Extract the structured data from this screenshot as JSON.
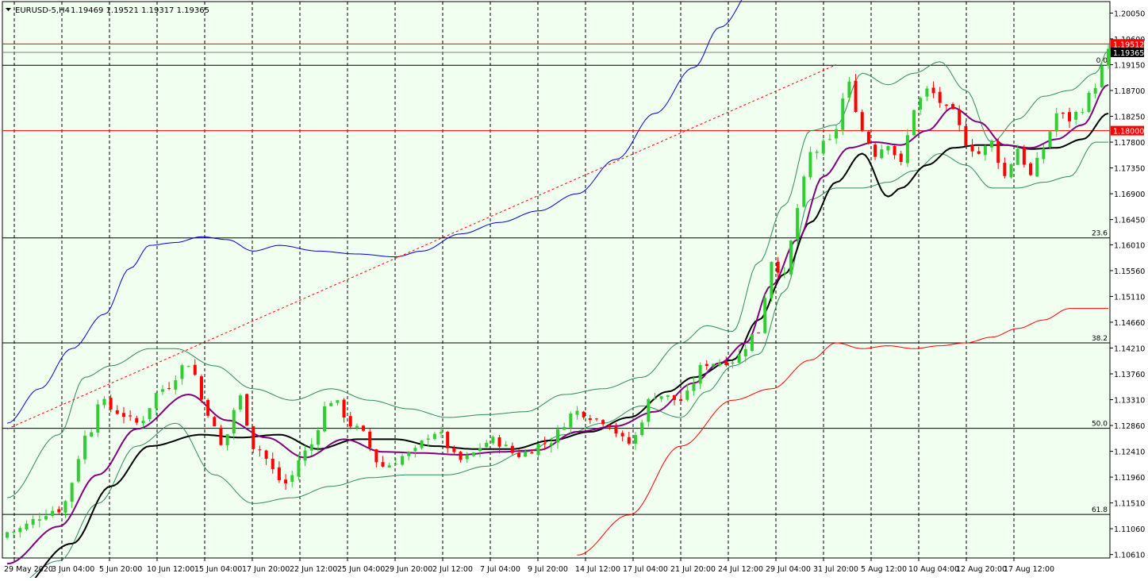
{
  "chart_data": {
    "type": "candlestick",
    "title": "EURUSD-5,H4",
    "ohlc_label": "1.19469 1.19521 1.19317 1.19365",
    "background_color": "#f0fff0",
    "colors": {
      "bull": "#32cd32",
      "bear": "#ff0000",
      "fib": "#000000",
      "hline": "#ff0000",
      "ma_short": "#800080",
      "ma_long": "#000000",
      "bollinger": "#2e8b57",
      "ma_upper": "#0000cd",
      "ma_lower": "#ff0000",
      "trend": "#ff0000"
    },
    "y_axis": {
      "ylim": [
        1.1055,
        1.2025
      ],
      "tick_labels": [
        "1.20050",
        "1.19600",
        "1.19150",
        "1.18700",
        "1.18250",
        "1.17800",
        "1.17350",
        "1.16900",
        "1.16450",
        "1.16010",
        "1.15560",
        "1.15110",
        "1.14660",
        "1.14210",
        "1.13760",
        "1.13310",
        "1.12860",
        "1.12410",
        "1.11960",
        "1.11510",
        "1.11060",
        "1.10610"
      ]
    },
    "x_axis": {
      "tick_labels": [
        "29 May 2020",
        "3 Jun 04:00",
        "5 Jun 20:00",
        "10 Jun 12:00",
        "15 Jun 04:00",
        "17 Jun 20:00",
        "22 Jun 12:00",
        "25 Jun 04:00",
        "29 Jun 20:00",
        "2 Jul 12:00",
        "7 Jul 04:00",
        "9 Jul 20:00",
        "14 Jul 12:00",
        "17 Jul 04:00",
        "21 Jul 20:00",
        "24 Jul 12:00",
        "29 Jul 04:00",
        "31 Jul 20:00",
        "5 Aug 12:00",
        "10 Aug 04:00",
        "12 Aug 20:00",
        "17 Aug 12:00"
      ]
    },
    "price_labels": [
      {
        "value": 1.19512,
        "text": "1.19512",
        "color": "#ff0000"
      },
      {
        "value": 1.19365,
        "text": "1.19365",
        "color": "#000000"
      },
      {
        "value": 1.18,
        "text": "1.18000",
        "color": "#ff0000"
      }
    ],
    "horizontal_lines": [
      {
        "value": 1.19512,
        "color": "#ff0000"
      },
      {
        "value": 1.18,
        "color": "#ff0000"
      },
      {
        "value": 1.19365,
        "color": "#808080"
      }
    ],
    "fibonacci_levels": [
      {
        "label": "0.0",
        "value": 1.1914
      },
      {
        "label": "23.6",
        "value": 1.1613
      },
      {
        "label": "38.2",
        "value": 1.143
      },
      {
        "label": "50.0",
        "value": 1.1281
      },
      {
        "label": "61.8",
        "value": 1.1131
      }
    ],
    "trendline": {
      "start": [
        0,
        1.128
      ],
      "end": [
        128,
        1.1915
      ]
    },
    "candle_count": 171,
    "anchors": {
      "close": [
        [
          0,
          1.11
        ],
        [
          8,
          1.114
        ],
        [
          13,
          1.128
        ],
        [
          14,
          1.133
        ],
        [
          17,
          1.131
        ],
        [
          20,
          1.129
        ],
        [
          24,
          1.135
        ],
        [
          28,
          1.1395
        ],
        [
          31,
          1.131
        ],
        [
          33,
          1.125
        ],
        [
          36,
          1.1335
        ],
        [
          38,
          1.125
        ],
        [
          43,
          1.1185
        ],
        [
          46,
          1.124
        ],
        [
          50,
          1.133
        ],
        [
          54,
          1.128
        ],
        [
          58,
          1.1215
        ],
        [
          62,
          1.1235
        ],
        [
          66,
          1.1275
        ],
        [
          70,
          1.1225
        ],
        [
          75,
          1.126
        ],
        [
          79,
          1.1235
        ],
        [
          83,
          1.1255
        ],
        [
          88,
          1.131
        ],
        [
          92,
          1.1295
        ],
        [
          96,
          1.1255
        ],
        [
          100,
          1.134
        ],
        [
          104,
          1.133
        ],
        [
          108,
          1.1395
        ],
        [
          112,
          1.14
        ],
        [
          116,
          1.145
        ],
        [
          118,
          1.1575
        ],
        [
          120,
          1.1545
        ],
        [
          122,
          1.1665
        ],
        [
          124,
          1.176
        ],
        [
          127,
          1.178
        ],
        [
          130,
          1.188
        ],
        [
          132,
          1.18
        ],
        [
          134,
          1.176
        ],
        [
          136,
          1.178
        ],
        [
          138,
          1.174
        ],
        [
          140,
          1.184
        ],
        [
          142,
          1.187
        ],
        [
          146,
          1.183
        ],
        [
          148,
          1.178
        ],
        [
          150,
          1.176
        ],
        [
          152,
          1.178
        ],
        [
          154,
          1.172
        ],
        [
          156,
          1.177
        ],
        [
          158,
          1.172
        ],
        [
          160,
          1.177
        ],
        [
          162,
          1.183
        ],
        [
          164,
          1.182
        ],
        [
          166,
          1.184
        ],
        [
          168,
          1.188
        ],
        [
          170,
          1.1937
        ]
      ],
      "ma_short": [
        [
          0,
          1.1045
        ],
        [
          8,
          1.111
        ],
        [
          14,
          1.12
        ],
        [
          20,
          1.128
        ],
        [
          28,
          1.134
        ],
        [
          34,
          1.1295
        ],
        [
          40,
          1.1265
        ],
        [
          46,
          1.123
        ],
        [
          52,
          1.1262
        ],
        [
          58,
          1.124
        ],
        [
          64,
          1.1238
        ],
        [
          70,
          1.1235
        ],
        [
          76,
          1.124
        ],
        [
          82,
          1.1243
        ],
        [
          88,
          1.1275
        ],
        [
          94,
          1.1285
        ],
        [
          100,
          1.131
        ],
        [
          106,
          1.136
        ],
        [
          110,
          1.1395
        ],
        [
          114,
          1.143
        ],
        [
          118,
          1.153
        ],
        [
          122,
          1.161
        ],
        [
          126,
          1.172
        ],
        [
          130,
          1.177
        ],
        [
          134,
          1.178
        ],
        [
          138,
          1.1775
        ],
        [
          142,
          1.18
        ],
        [
          146,
          1.184
        ],
        [
          150,
          1.1815
        ],
        [
          154,
          1.1775
        ],
        [
          158,
          1.177
        ],
        [
          162,
          1.1785
        ],
        [
          166,
          1.181
        ],
        [
          170,
          1.188
        ]
      ],
      "ma_long": [
        [
          0,
          1.098
        ],
        [
          10,
          1.108
        ],
        [
          16,
          1.118
        ],
        [
          22,
          1.125
        ],
        [
          30,
          1.127
        ],
        [
          36,
          1.1265
        ],
        [
          42,
          1.127
        ],
        [
          48,
          1.1245
        ],
        [
          54,
          1.1262
        ],
        [
          60,
          1.1262
        ],
        [
          66,
          1.125
        ],
        [
          72,
          1.1245
        ],
        [
          78,
          1.1245
        ],
        [
          84,
          1.126
        ],
        [
          90,
          1.1275
        ],
        [
          96,
          1.13
        ],
        [
          102,
          1.1345
        ],
        [
          106,
          1.137
        ],
        [
          112,
          1.14
        ],
        [
          116,
          1.147
        ],
        [
          120,
          1.155
        ],
        [
          124,
          1.164
        ],
        [
          128,
          1.171
        ],
        [
          132,
          1.176
        ],
        [
          136,
          1.1685
        ],
        [
          138,
          1.17
        ],
        [
          142,
          1.174
        ],
        [
          146,
          1.177
        ],
        [
          150,
          1.1775
        ],
        [
          154,
          1.1775
        ],
        [
          158,
          1.1768
        ],
        [
          162,
          1.177
        ],
        [
          166,
          1.1785
        ],
        [
          170,
          1.183
        ]
      ],
      "boll_upper": [
        [
          0,
          1.116
        ],
        [
          8,
          1.127
        ],
        [
          12,
          1.137
        ],
        [
          16,
          1.139
        ],
        [
          22,
          1.142
        ],
        [
          26,
          1.142
        ],
        [
          32,
          1.139
        ],
        [
          38,
          1.135
        ],
        [
          44,
          1.133
        ],
        [
          50,
          1.135
        ],
        [
          56,
          1.133
        ],
        [
          62,
          1.1315
        ],
        [
          68,
          1.13
        ],
        [
          74,
          1.1305
        ],
        [
          80,
          1.131
        ],
        [
          86,
          1.134
        ],
        [
          92,
          1.135
        ],
        [
          98,
          1.137
        ],
        [
          104,
          1.143
        ],
        [
          108,
          1.146
        ],
        [
          112,
          1.145
        ],
        [
          116,
          1.157
        ],
        [
          120,
          1.167
        ],
        [
          124,
          1.18
        ],
        [
          128,
          1.181
        ],
        [
          132,
          1.19
        ],
        [
          136,
          1.188
        ],
        [
          140,
          1.19
        ],
        [
          144,
          1.192
        ],
        [
          148,
          1.187
        ],
        [
          152,
          1.178
        ],
        [
          156,
          1.182
        ],
        [
          160,
          1.186
        ],
        [
          164,
          1.187
        ],
        [
          168,
          1.19
        ],
        [
          170,
          1.194
        ]
      ],
      "boll_lower": [
        [
          0,
          1.1
        ],
        [
          8,
          1.105
        ],
        [
          14,
          1.115
        ],
        [
          20,
          1.125
        ],
        [
          26,
          1.129
        ],
        [
          32,
          1.12
        ],
        [
          38,
          1.115
        ],
        [
          44,
          1.116
        ],
        [
          50,
          1.118
        ],
        [
          56,
          1.1195
        ],
        [
          62,
          1.12
        ],
        [
          68,
          1.12
        ],
        [
          74,
          1.1215
        ],
        [
          80,
          1.124
        ],
        [
          86,
          1.127
        ],
        [
          92,
          1.129
        ],
        [
          98,
          1.132
        ],
        [
          104,
          1.13
        ],
        [
          108,
          1.1345
        ],
        [
          112,
          1.139
        ],
        [
          116,
          1.141
        ],
        [
          120,
          1.152
        ],
        [
          124,
          1.168
        ],
        [
          128,
          1.17
        ],
        [
          132,
          1.17
        ],
        [
          136,
          1.171
        ],
        [
          140,
          1.173
        ],
        [
          144,
          1.176
        ],
        [
          148,
          1.174
        ],
        [
          152,
          1.17
        ],
        [
          156,
          1.17
        ],
        [
          160,
          1.171
        ],
        [
          164,
          1.172
        ],
        [
          168,
          1.178
        ],
        [
          170,
          1.178
        ]
      ],
      "ma_upper": [
        [
          0,
          1.129
        ],
        [
          5,
          1.135
        ],
        [
          10,
          1.142
        ],
        [
          15,
          1.148
        ],
        [
          19,
          1.156
        ],
        [
          22,
          1.16
        ],
        [
          26,
          1.1605
        ],
        [
          30,
          1.1615
        ],
        [
          34,
          1.161
        ],
        [
          38,
          1.159
        ],
        [
          42,
          1.16
        ],
        [
          48,
          1.159
        ],
        [
          54,
          1.1585
        ],
        [
          60,
          1.158
        ],
        [
          64,
          1.159
        ],
        [
          70,
          1.162
        ],
        [
          76,
          1.164
        ],
        [
          82,
          1.166
        ],
        [
          88,
          1.169
        ],
        [
          94,
          1.175
        ],
        [
          100,
          1.183
        ],
        [
          106,
          1.191
        ],
        [
          110,
          1.198
        ],
        [
          116,
          1.206
        ],
        [
          118,
          1.21
        ]
      ],
      "ma_lower": [
        [
          88,
          1.106
        ],
        [
          96,
          1.113
        ],
        [
          104,
          1.125
        ],
        [
          112,
          1.133
        ],
        [
          118,
          1.135
        ],
        [
          124,
          1.14
        ],
        [
          128,
          1.143
        ],
        [
          132,
          1.142
        ],
        [
          136,
          1.1425
        ],
        [
          140,
          1.142
        ],
        [
          144,
          1.1425
        ],
        [
          148,
          1.143
        ],
        [
          152,
          1.144
        ],
        [
          156,
          1.1455
        ],
        [
          160,
          1.147
        ],
        [
          164,
          1.149
        ],
        [
          170,
          1.149
        ]
      ]
    }
  }
}
